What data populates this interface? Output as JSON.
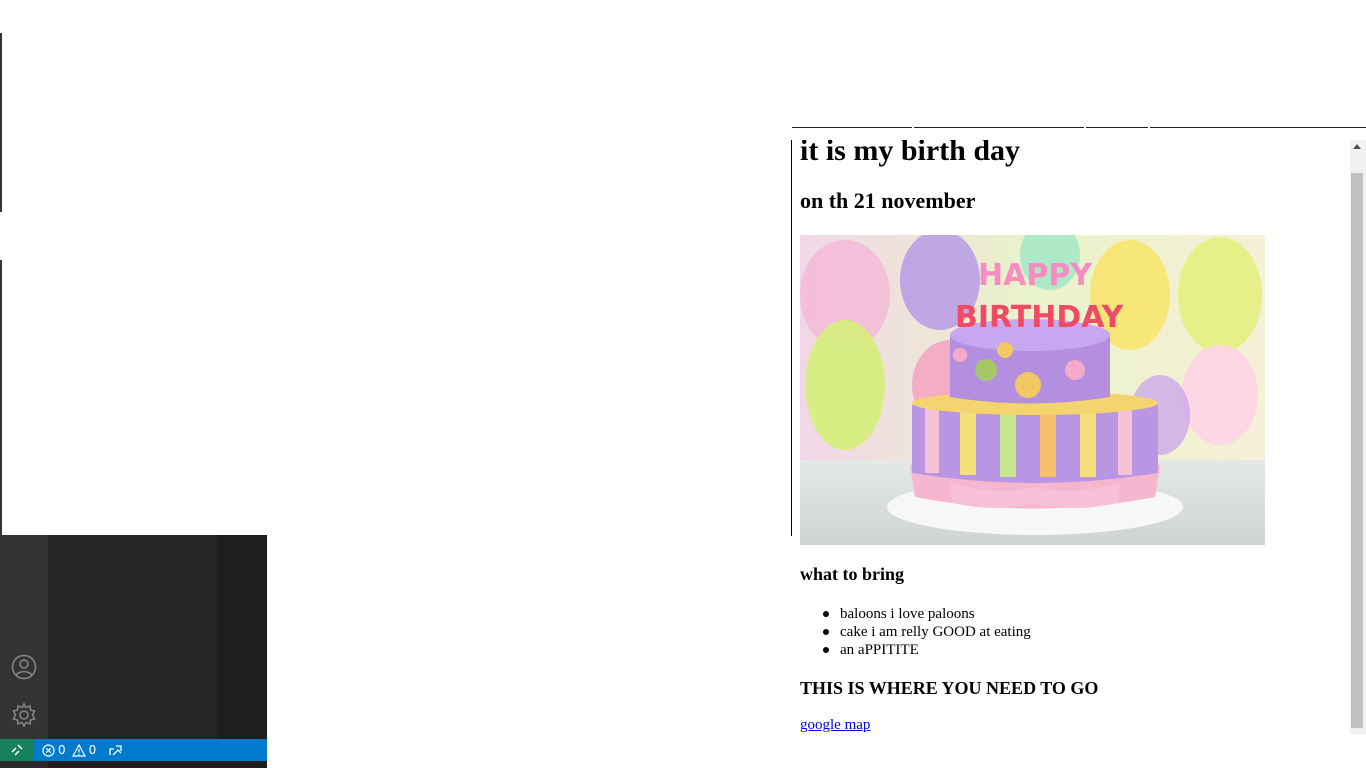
{
  "preview": {
    "heading": "it is my birth day",
    "subheading": "on th 21 november",
    "image_text": "HAPPY BIRTHDAY",
    "bring_heading": "what to bring",
    "bring_items": [
      "baloons i love paloons",
      "cake i am relly GOOD at eating",
      "an aPPITITE"
    ],
    "where_heading": "THIS IS WHERE YOU NEED TO GO",
    "map_link": "google map"
  },
  "statusbar": {
    "errors": "0",
    "warnings": "0"
  },
  "icons": {
    "remote": "remote-icon",
    "account": "account-icon",
    "settings": "gear-icon",
    "errors": "error-icon",
    "warnings": "warning-icon",
    "live_share": "live-share-icon"
  },
  "colors": {
    "statusbar": "#007acc",
    "remote": "#16825d",
    "activity_bar": "#333333",
    "sidebar": "#252526",
    "link": "#0000ee"
  }
}
